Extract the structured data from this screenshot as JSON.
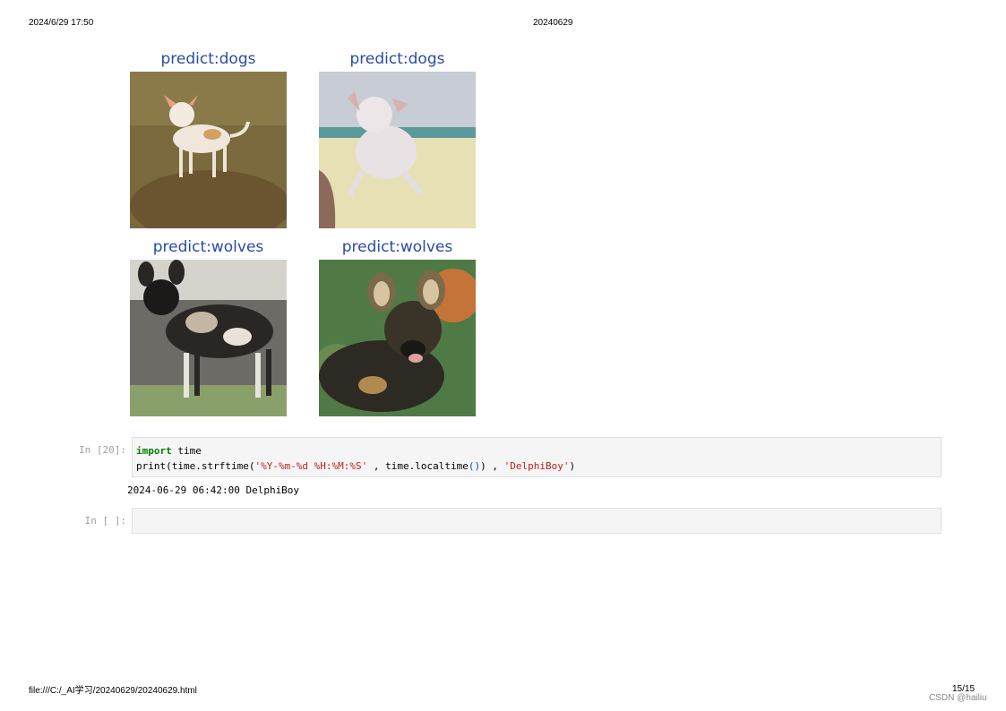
{
  "header": {
    "datetime": "2024/6/29 17:50",
    "title": "20240629"
  },
  "footer": {
    "path": "file:///C:/_AI学习/20240629/20240629.html",
    "page": "15/15",
    "watermark": "CSDN @hailiu"
  },
  "predictions": [
    {
      "label": "predict:dogs"
    },
    {
      "label": "predict:dogs"
    },
    {
      "label": "predict:wolves"
    },
    {
      "label": "predict:wolves"
    }
  ],
  "cells": [
    {
      "prompt": "In [20]:",
      "code": {
        "line1_kw": "import",
        "line1_rest": " time",
        "line2_a": "print(time.strftime(",
        "line2_str1": "'%Y-%m-%d %H:%M:%S'",
        "line2_b": " , time.localtime",
        "line2_paren": "()",
        "line2_c": ") , ",
        "line2_str2": "'DelphiBoy'",
        "line2_d": ")"
      },
      "output": "2024-06-29 06:42:00 DelphiBoy"
    },
    {
      "prompt": "In [ ]:"
    }
  ]
}
